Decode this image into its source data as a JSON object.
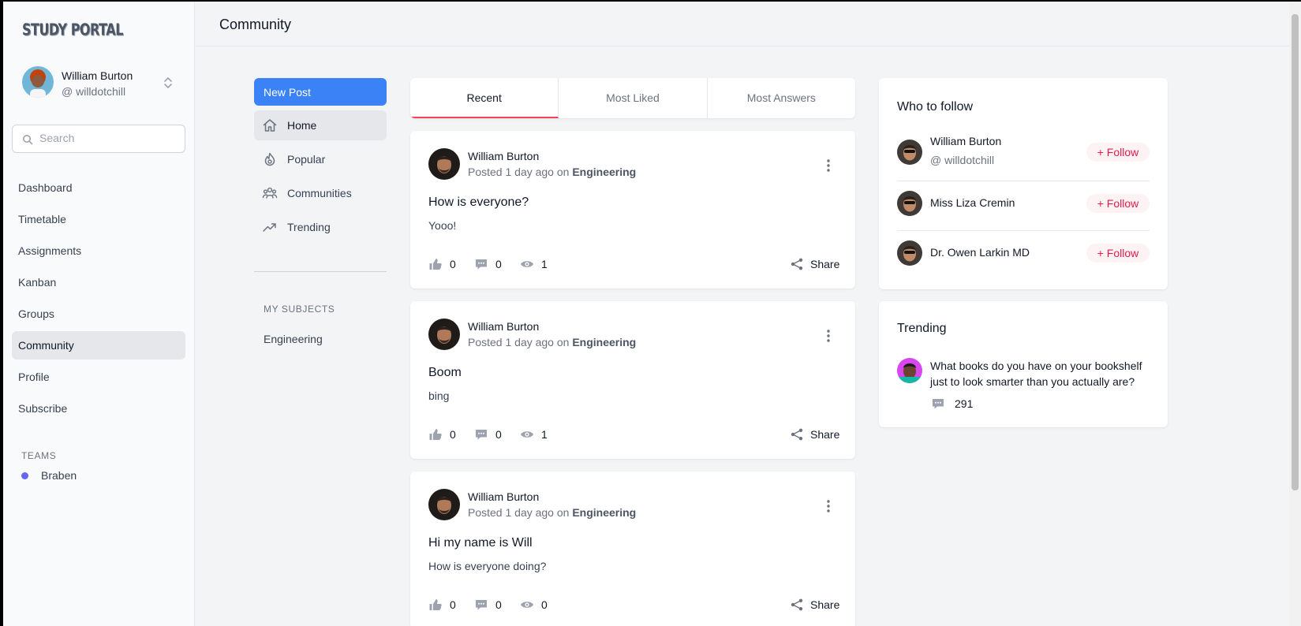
{
  "app": {
    "logo_text": "STUDY PORTAL"
  },
  "user": {
    "name": "William Burton",
    "handle": "@ willdotchill"
  },
  "search": {
    "placeholder": "Search",
    "value": ""
  },
  "sidebar": {
    "items": [
      {
        "label": "Dashboard",
        "active": false
      },
      {
        "label": "Timetable",
        "active": false
      },
      {
        "label": "Assignments",
        "active": false
      },
      {
        "label": "Kanban",
        "active": false
      },
      {
        "label": "Groups",
        "active": false
      },
      {
        "label": "Community",
        "active": true
      },
      {
        "label": "Profile",
        "active": false
      },
      {
        "label": "Subscribe",
        "active": false
      }
    ],
    "teams_heading": "TEAMS",
    "teams": [
      {
        "label": "Braben",
        "color": "#6366f1"
      }
    ]
  },
  "header": {
    "title": "Community"
  },
  "community_nav": {
    "new_post_label": "New Post",
    "items": [
      {
        "label": "Home",
        "icon": "home-icon",
        "active": true
      },
      {
        "label": "Popular",
        "icon": "fire-icon",
        "active": false
      },
      {
        "label": "Communities",
        "icon": "users-icon",
        "active": false
      },
      {
        "label": "Trending",
        "icon": "trending-up-icon",
        "active": false
      }
    ],
    "subjects_heading": "MY SUBJECTS",
    "subjects": [
      "Engineering"
    ]
  },
  "feed": {
    "tabs": [
      {
        "label": "Recent",
        "active": true
      },
      {
        "label": "Most Liked",
        "active": false
      },
      {
        "label": "Most Answers",
        "active": false
      }
    ],
    "posts": [
      {
        "author": "William Burton",
        "posted": "Posted 1 day ago on",
        "subject": "Engineering",
        "title": "How is everyone?",
        "body": "Yooo!",
        "likes": "0",
        "comments": "0",
        "views": "1",
        "share_label": "Share"
      },
      {
        "author": "William Burton",
        "posted": "Posted 1 day ago on",
        "subject": "Engineering",
        "title": "Boom",
        "body": "bing",
        "likes": "0",
        "comments": "0",
        "views": "1",
        "share_label": "Share"
      },
      {
        "author": "William Burton",
        "posted": "Posted 1 day ago on",
        "subject": "Engineering",
        "title": "Hi my name is Will",
        "body": "How is everyone doing?",
        "likes": "0",
        "comments": "0",
        "views": "0",
        "share_label": "Share"
      }
    ]
  },
  "who_to_follow": {
    "title": "Who to follow",
    "follow_label": "+ Follow",
    "people": [
      {
        "name": "William Burton",
        "handle": "@ willdotchill"
      },
      {
        "name": "Miss Liza Cremin",
        "handle": ""
      },
      {
        "name": "Dr. Owen Larkin MD",
        "handle": ""
      }
    ]
  },
  "trending": {
    "title": "Trending",
    "items": [
      {
        "text": "What books do you have on your bookshelf just to look smarter than you actually are?",
        "comments": "291"
      }
    ]
  },
  "colors": {
    "primary": "#3b82f6",
    "accent": "#f43f5e",
    "follow_text": "#e11d48",
    "team_dot": "#6366f1"
  }
}
